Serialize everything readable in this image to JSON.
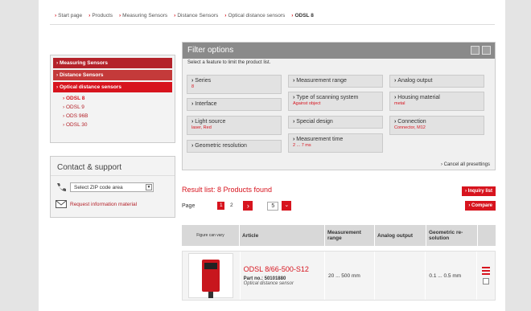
{
  "breadcrumb": [
    "Start page",
    "Products",
    "Measuring Sensors",
    "Distance Sensors",
    "Optical distance sensors",
    "ODSL 8"
  ],
  "nav": {
    "levels": [
      "Measuring Sensors",
      "Distance Sensors",
      "Optical distance sensors"
    ],
    "sub": [
      "ODSL 8",
      "ODSL 9",
      "ODS 96B",
      "ODSL 30"
    ]
  },
  "contact": {
    "title": "Contact & support",
    "zip_placeholder": "Select ZIP code area",
    "request": "Request information material"
  },
  "filter": {
    "title": "Filter options",
    "hint": "Select a feature to limit the product list.",
    "boxes": [
      {
        "label": "Series",
        "value": "8"
      },
      {
        "label": "Interface",
        "value": ""
      },
      {
        "label": "Light source",
        "value": "laser, Red"
      },
      {
        "label": "Geometric resolution",
        "value": ""
      },
      {
        "label": "Measurement range",
        "value": ""
      },
      {
        "label": "Type of scanning system",
        "value": "Against object"
      },
      {
        "label": "Special design",
        "value": ""
      },
      {
        "label": "Measurement time",
        "value": "2 ... 7 ms"
      },
      {
        "label": "Analog output",
        "value": ""
      },
      {
        "label": "Housing material",
        "value": "metal"
      },
      {
        "label": "Connection",
        "value": "Connector, M12"
      }
    ],
    "cancel": "Cancel all presettings"
  },
  "results": {
    "title": "Result list: 8 Products found",
    "page_label": "Page",
    "pages": [
      "1",
      "2"
    ],
    "per_page": "5",
    "inquiry": "Inquiry list",
    "compare": "Compare"
  },
  "table": {
    "headers": [
      "Figure can vary",
      "Article",
      "Measurement range",
      "Analog output",
      "Geometric re-solution"
    ],
    "rows": [
      {
        "name": "ODSL 8/66-500-S12",
        "part": "Part no.: 50101880",
        "desc": "Optical distance sensor",
        "range": "20 ... 500 mm",
        "analog": "",
        "resolution": "0.1 ... 0.5 mm"
      }
    ]
  },
  "colors": {
    "accent": "#d7141e",
    "filter_header": "#8a8a8a"
  }
}
